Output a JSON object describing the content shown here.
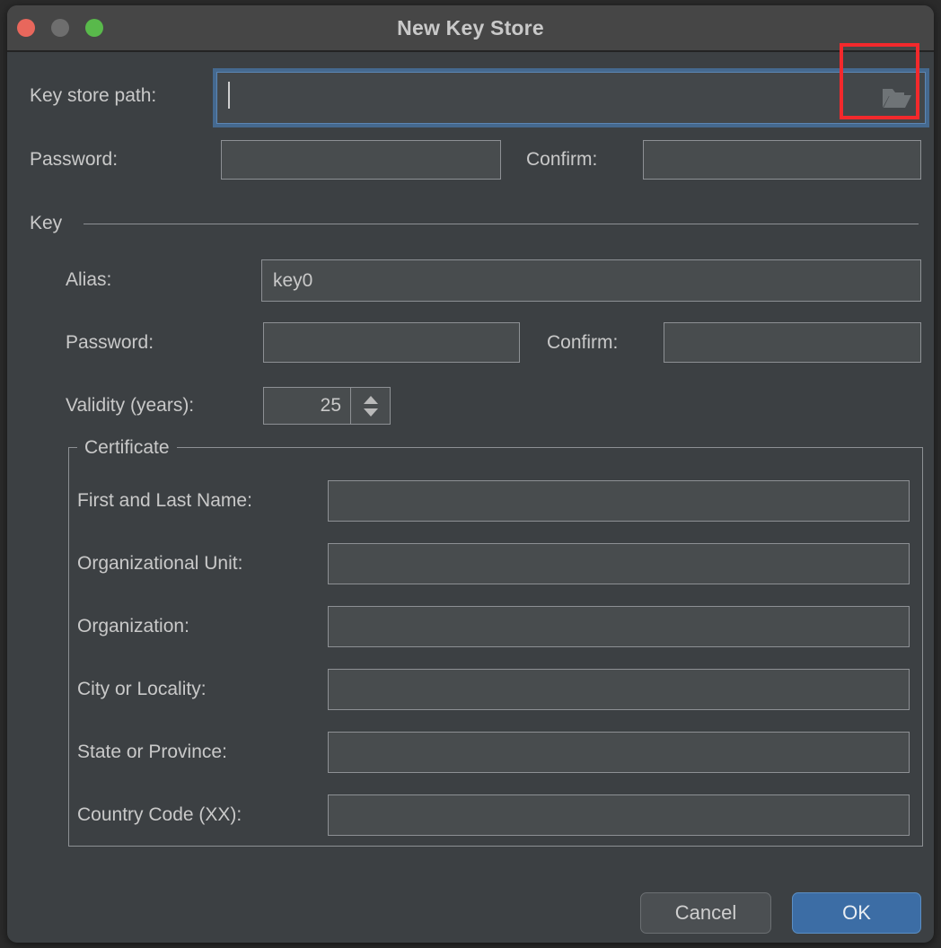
{
  "window": {
    "title": "New Key Store",
    "traffic_lights": [
      {
        "name": "close",
        "color": "#e8675c"
      },
      {
        "name": "minimize",
        "color": "#6e6e6e"
      },
      {
        "name": "maximize",
        "color": "#59b94b"
      }
    ],
    "background": "#3c4043",
    "titlebar_background": "#464646"
  },
  "form": {
    "key_store_path": {
      "label": "Key store path:",
      "value": "",
      "focused": true,
      "browse_icon": "folder-icon"
    },
    "store_password": {
      "label": "Password:",
      "value": ""
    },
    "store_confirm": {
      "label": "Confirm:",
      "value": ""
    }
  },
  "key_section": {
    "title": "Key",
    "alias": {
      "label": "Alias:",
      "value": "key0"
    },
    "key_password": {
      "label": "Password:",
      "value": ""
    },
    "key_confirm": {
      "label": "Confirm:",
      "value": ""
    },
    "validity": {
      "label": "Validity (years):",
      "value": "25"
    }
  },
  "certificate": {
    "title": "Certificate",
    "fields": [
      {
        "label": "First and Last Name:",
        "value": ""
      },
      {
        "label": "Organizational Unit:",
        "value": ""
      },
      {
        "label": "Organization:",
        "value": ""
      },
      {
        "label": "City or Locality:",
        "value": ""
      },
      {
        "label": "State or Province:",
        "value": ""
      },
      {
        "label": "Country Code (XX):",
        "value": ""
      }
    ]
  },
  "buttons": {
    "cancel": "Cancel",
    "ok": "OK",
    "ok_color": "#3c6da5"
  },
  "annotation": {
    "color": "#f3292c",
    "target": "browse-folder-button"
  }
}
